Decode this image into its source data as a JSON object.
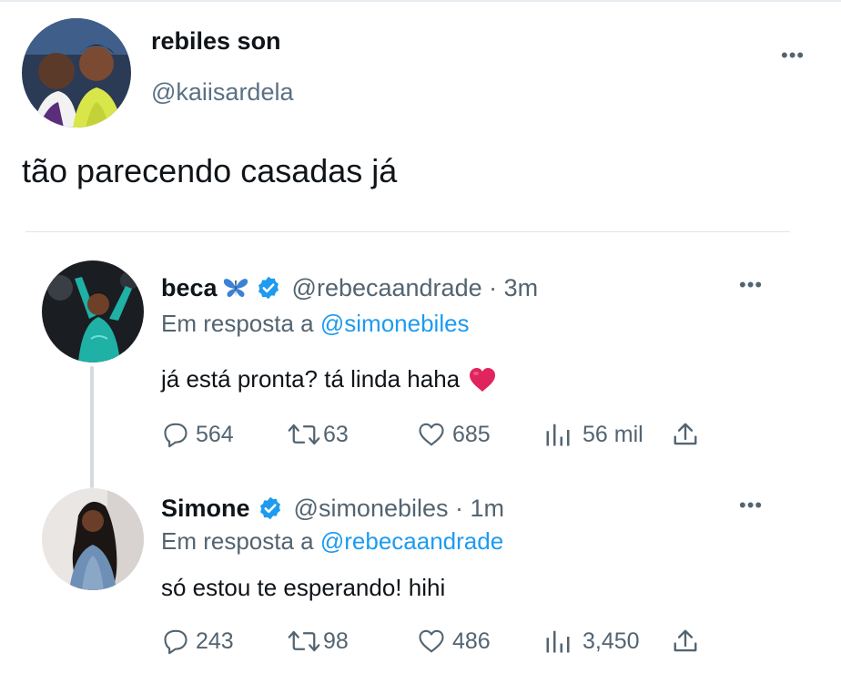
{
  "original": {
    "name": "rebiles son",
    "handle": "@kaiisardela",
    "text": "tão parecendo casadas já",
    "more_icon": "•••"
  },
  "tweets": [
    {
      "name": "beca",
      "name_emoji": "butterfly-emoji",
      "verified": true,
      "handle_time": "@rebecaandrade · 3m",
      "reply_prefix": "Em resposta a",
      "reply_handle": "@simonebiles",
      "text": "já está pronta? tá linda haha",
      "text_emoji": "❤️",
      "replies": "564",
      "retweets": "63",
      "likes": "685",
      "views": "56 mil",
      "more_icon": "•••"
    },
    {
      "name": "Simone",
      "verified": true,
      "handle_time": "@simonebiles · 1m",
      "reply_prefix": "Em resposta a",
      "reply_handle": "@rebecaandrade",
      "text": "só estou te esperando! hihi",
      "replies": "243",
      "retweets": "98",
      "likes": "486",
      "views": "3,450",
      "more_icon": "•••"
    }
  ],
  "colors": {
    "link": "#1d9bf0",
    "secondary": "#536471",
    "verified": "#1d9bf0",
    "heart": "#e0245e"
  }
}
